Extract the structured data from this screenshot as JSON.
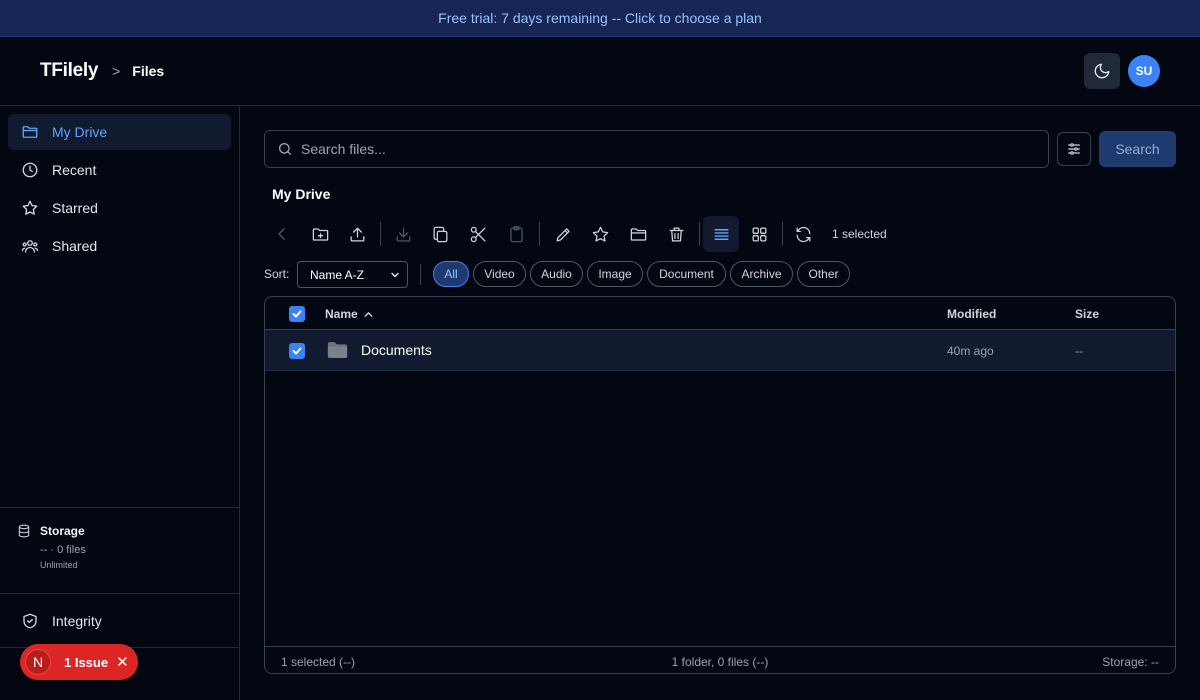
{
  "banner": {
    "text": "Free trial: 7 days remaining -- Click to choose a plan"
  },
  "header": {
    "brand": "TFilely",
    "breadcrumb_separator": ">",
    "breadcrumb_current": "Files",
    "avatar_initials": "SU",
    "theme_icon": "moon-icon"
  },
  "sidebar": {
    "items": [
      {
        "label": "My Drive",
        "icon": "folder-icon",
        "active": true
      },
      {
        "label": "Recent",
        "icon": "clock-icon",
        "active": false
      },
      {
        "label": "Starred",
        "icon": "star-icon",
        "active": false
      },
      {
        "label": "Shared",
        "icon": "users-icon",
        "active": false
      }
    ],
    "storage": {
      "title": "Storage",
      "usage": "-- · 0 files",
      "limit": "Unlimited"
    },
    "integrity_label": "Integrity"
  },
  "issue_badge": {
    "initial": "N",
    "label": "1 Issue",
    "color": "#dc2626"
  },
  "search": {
    "placeholder": "Search files...",
    "value": "",
    "button_label": "Search"
  },
  "main": {
    "title": "My Drive",
    "selected_count": "1 selected",
    "toolbar_icons": [
      "back-icon",
      "new-folder-icon",
      "upload-icon",
      "download-icon",
      "copy-icon",
      "cut-icon",
      "paste-icon",
      "rename-icon",
      "star-icon",
      "move-icon",
      "delete-icon",
      "list-view-icon",
      "grid-view-icon",
      "refresh-icon"
    ]
  },
  "filters": {
    "sort_label": "Sort:",
    "sort_value": "Name A-Z",
    "chips": [
      "All",
      "Video",
      "Audio",
      "Image",
      "Document",
      "Archive",
      "Other"
    ],
    "active_chip": "All"
  },
  "table": {
    "columns": {
      "name": "Name",
      "modified": "Modified",
      "size": "Size"
    },
    "sort_indicator": "ascending",
    "rows": [
      {
        "name": "Documents",
        "type": "folder",
        "modified": "40m ago",
        "size": "--",
        "selected": true
      }
    ],
    "footer": {
      "left": "1 selected (--)",
      "center": "1 folder, 0 files (--)",
      "right": "Storage: --"
    }
  },
  "colors": {
    "accent": "#3b82f6",
    "background": "#030712",
    "banner_bg": "#172554",
    "banner_text": "#93c5fd",
    "active_bg": "#111a2e"
  }
}
